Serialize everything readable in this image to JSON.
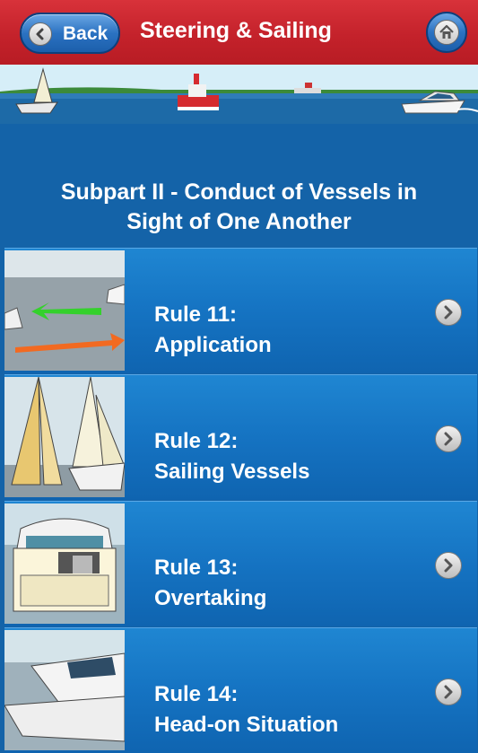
{
  "header": {
    "back_label": "Back",
    "title": "Steering & Sailing",
    "accent": "#c4222b"
  },
  "section": {
    "title_line1": "Subpart II - Conduct of Vessels in",
    "title_line2": "Sight of One Another"
  },
  "rules": [
    {
      "line1": "Rule 11:",
      "line2": "Application"
    },
    {
      "line1": "Rule 12:",
      "line2": "Sailing Vessels"
    },
    {
      "line1": "Rule 13:",
      "line2": "Overtaking"
    },
    {
      "line1": "Rule 14:",
      "line2": "Head-on Situation"
    }
  ],
  "icons": [
    "back-arrow-icon",
    "home-icon",
    "chevron-right-icon"
  ]
}
